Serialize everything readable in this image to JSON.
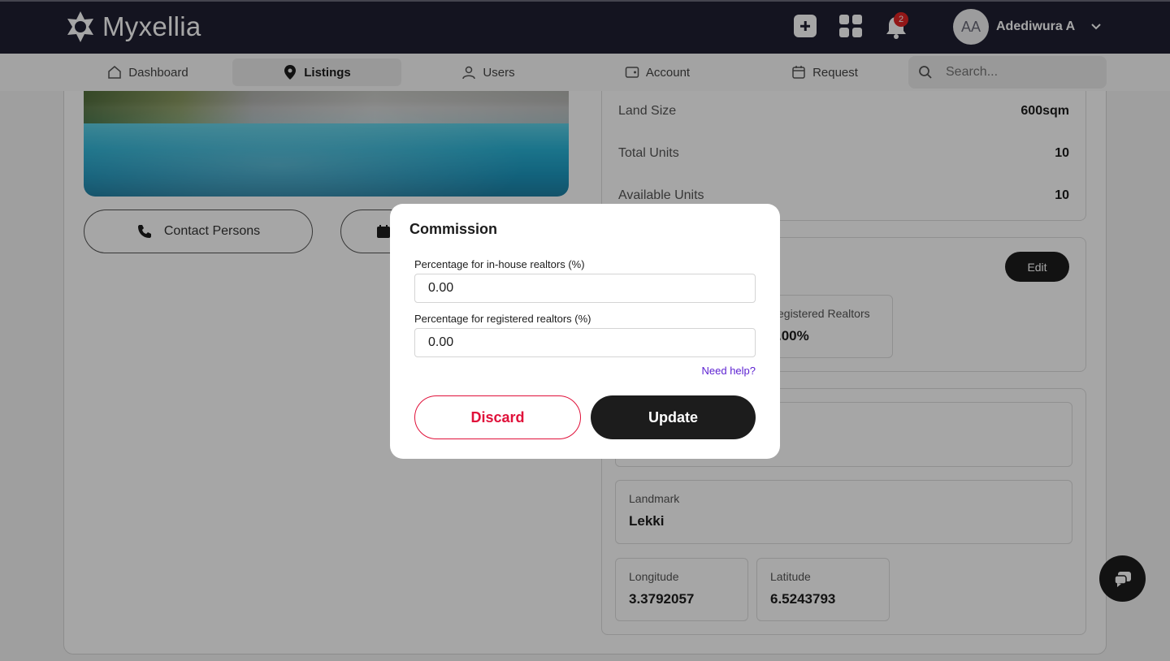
{
  "app": {
    "brand": "Myxellia",
    "notification_count": "2",
    "user_initials": "AA",
    "user_name": "Adediwura A"
  },
  "nav": {
    "items": [
      {
        "label": "Dashboard",
        "icon": "home-icon"
      },
      {
        "label": "Listings",
        "icon": "location-pin-icon",
        "active": true
      },
      {
        "label": "Users",
        "icon": "user-icon"
      },
      {
        "label": "Account",
        "icon": "wallet-icon"
      },
      {
        "label": "Request",
        "icon": "calendar-icon"
      }
    ],
    "search_placeholder": "Search..."
  },
  "listing": {
    "contact_button": "Contact Persons",
    "details": [
      {
        "label": "Land Size",
        "value": "600sqm"
      },
      {
        "label": "Total Units",
        "value": "10"
      },
      {
        "label": "Available Units",
        "value": "10"
      }
    ],
    "commission": {
      "edit_label": "Edit",
      "registered_label": "egistered Realtors",
      "registered_value": ".00%"
    },
    "location": {
      "landmark_label": "Landmark",
      "landmark_value": "Lekki",
      "longitude_label": "Longitude",
      "longitude_value": "3.3792057",
      "latitude_label": "Latitude",
      "latitude_value": "6.5243793"
    }
  },
  "modal": {
    "title": "Commission",
    "inhouse_label": "Percentage for in-house realtors (%)",
    "inhouse_value": "0.00",
    "registered_label": "Percentage for registered realtors (%)",
    "registered_value": "0.00",
    "help_link": "Need help?",
    "discard_label": "Discard",
    "update_label": "Update"
  },
  "colors": {
    "topbar": "#1f2032",
    "discard": "#e0113a",
    "primary": "#1c1c1c",
    "link": "#5b1fd1",
    "badge": "#e02424"
  }
}
